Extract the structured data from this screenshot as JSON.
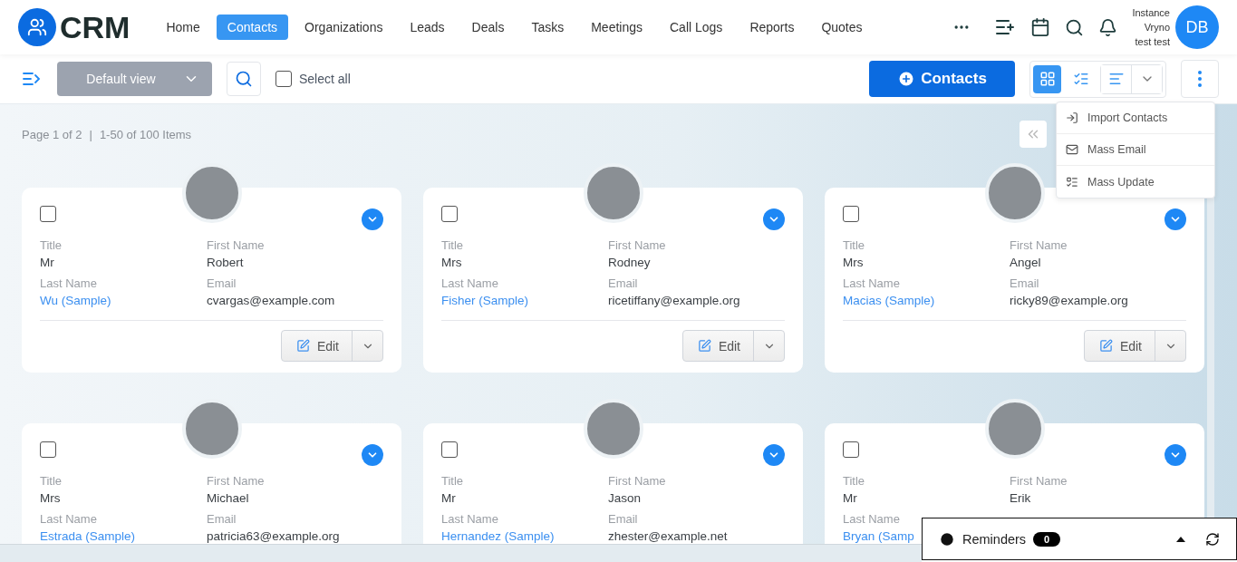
{
  "brand": {
    "name": "CRM"
  },
  "nav": [
    {
      "label": "Home",
      "selected": false
    },
    {
      "label": "Contacts",
      "selected": true
    },
    {
      "label": "Organizations",
      "selected": false
    },
    {
      "label": "Leads",
      "selected": false
    },
    {
      "label": "Deals",
      "selected": false
    },
    {
      "label": "Tasks",
      "selected": false
    },
    {
      "label": "Meetings",
      "selected": false
    },
    {
      "label": "Call Logs",
      "selected": false
    },
    {
      "label": "Reports",
      "selected": false
    },
    {
      "label": "Quotes",
      "selected": false
    }
  ],
  "user": {
    "lines": [
      "Instance",
      "Vryno",
      "test test"
    ],
    "initials": "DB"
  },
  "toolbar": {
    "view_select": "Default view",
    "select_all": {
      "label": "Select all",
      "checked": false
    },
    "add_button": "Contacts",
    "views": [
      {
        "kind": "grid",
        "selected": true
      },
      {
        "kind": "list",
        "selected": false
      },
      {
        "kind": "kanban",
        "selected": false
      }
    ]
  },
  "menu": [
    {
      "kind": "import",
      "label": "Import Contacts"
    },
    {
      "kind": "email",
      "label": "Mass Email"
    },
    {
      "kind": "update",
      "label": "Mass Update"
    }
  ],
  "pagination": {
    "page": "Page 1 of 2",
    "separator": "|",
    "range": "1-50 of 100 Items"
  },
  "cards": [
    {
      "checked": false,
      "edit": "Edit",
      "fields": [
        {
          "label": "Title",
          "value": "Mr",
          "kind": "text"
        },
        {
          "label": "First Name",
          "value": "Robert",
          "kind": "text"
        },
        {
          "label": "Last Name",
          "value": "Wu (Sample)",
          "kind": "link"
        },
        {
          "label": "Email",
          "value": "cvargas@example.com",
          "kind": "text"
        }
      ]
    },
    {
      "checked": false,
      "edit": "Edit",
      "fields": [
        {
          "label": "Title",
          "value": "Mrs",
          "kind": "text"
        },
        {
          "label": "First Name",
          "value": "Rodney",
          "kind": "text"
        },
        {
          "label": "Last Name",
          "value": "Fisher (Sample)",
          "kind": "link"
        },
        {
          "label": "Email",
          "value": "ricetiffany@example.org",
          "kind": "text"
        }
      ]
    },
    {
      "checked": false,
      "edit": "Edit",
      "fields": [
        {
          "label": "Title",
          "value": "Mrs",
          "kind": "text"
        },
        {
          "label": "First Name",
          "value": "Angel",
          "kind": "text"
        },
        {
          "label": "Last Name",
          "value": "Macias (Sample)",
          "kind": "link"
        },
        {
          "label": "Email",
          "value": "ricky89@example.org",
          "kind": "text"
        }
      ]
    },
    {
      "checked": false,
      "fields": [
        {
          "label": "Title",
          "value": "Mrs",
          "kind": "text"
        },
        {
          "label": "First Name",
          "value": "Michael",
          "kind": "text"
        },
        {
          "label": "Last Name",
          "value": "Estrada (Sample)",
          "kind": "link"
        },
        {
          "label": "Email",
          "value": "patricia63@example.org",
          "kind": "text"
        }
      ]
    },
    {
      "checked": false,
      "fields": [
        {
          "label": "Title",
          "value": "Mr",
          "kind": "text"
        },
        {
          "label": "First Name",
          "value": "Jason",
          "kind": "text"
        },
        {
          "label": "Last Name",
          "value": "Hernandez (Sample)",
          "kind": "link"
        },
        {
          "label": "Email",
          "value": "zhester@example.net",
          "kind": "text"
        }
      ]
    },
    {
      "checked": false,
      "fields": [
        {
          "label": "Title",
          "value": "Mr",
          "kind": "text"
        },
        {
          "label": "First Name",
          "value": "Erik",
          "kind": "text"
        },
        {
          "label": "Last Name",
          "value": "Bryan (Samp",
          "kind": "link"
        }
      ]
    }
  ],
  "reminders": {
    "label": "Reminders",
    "count": "0"
  }
}
